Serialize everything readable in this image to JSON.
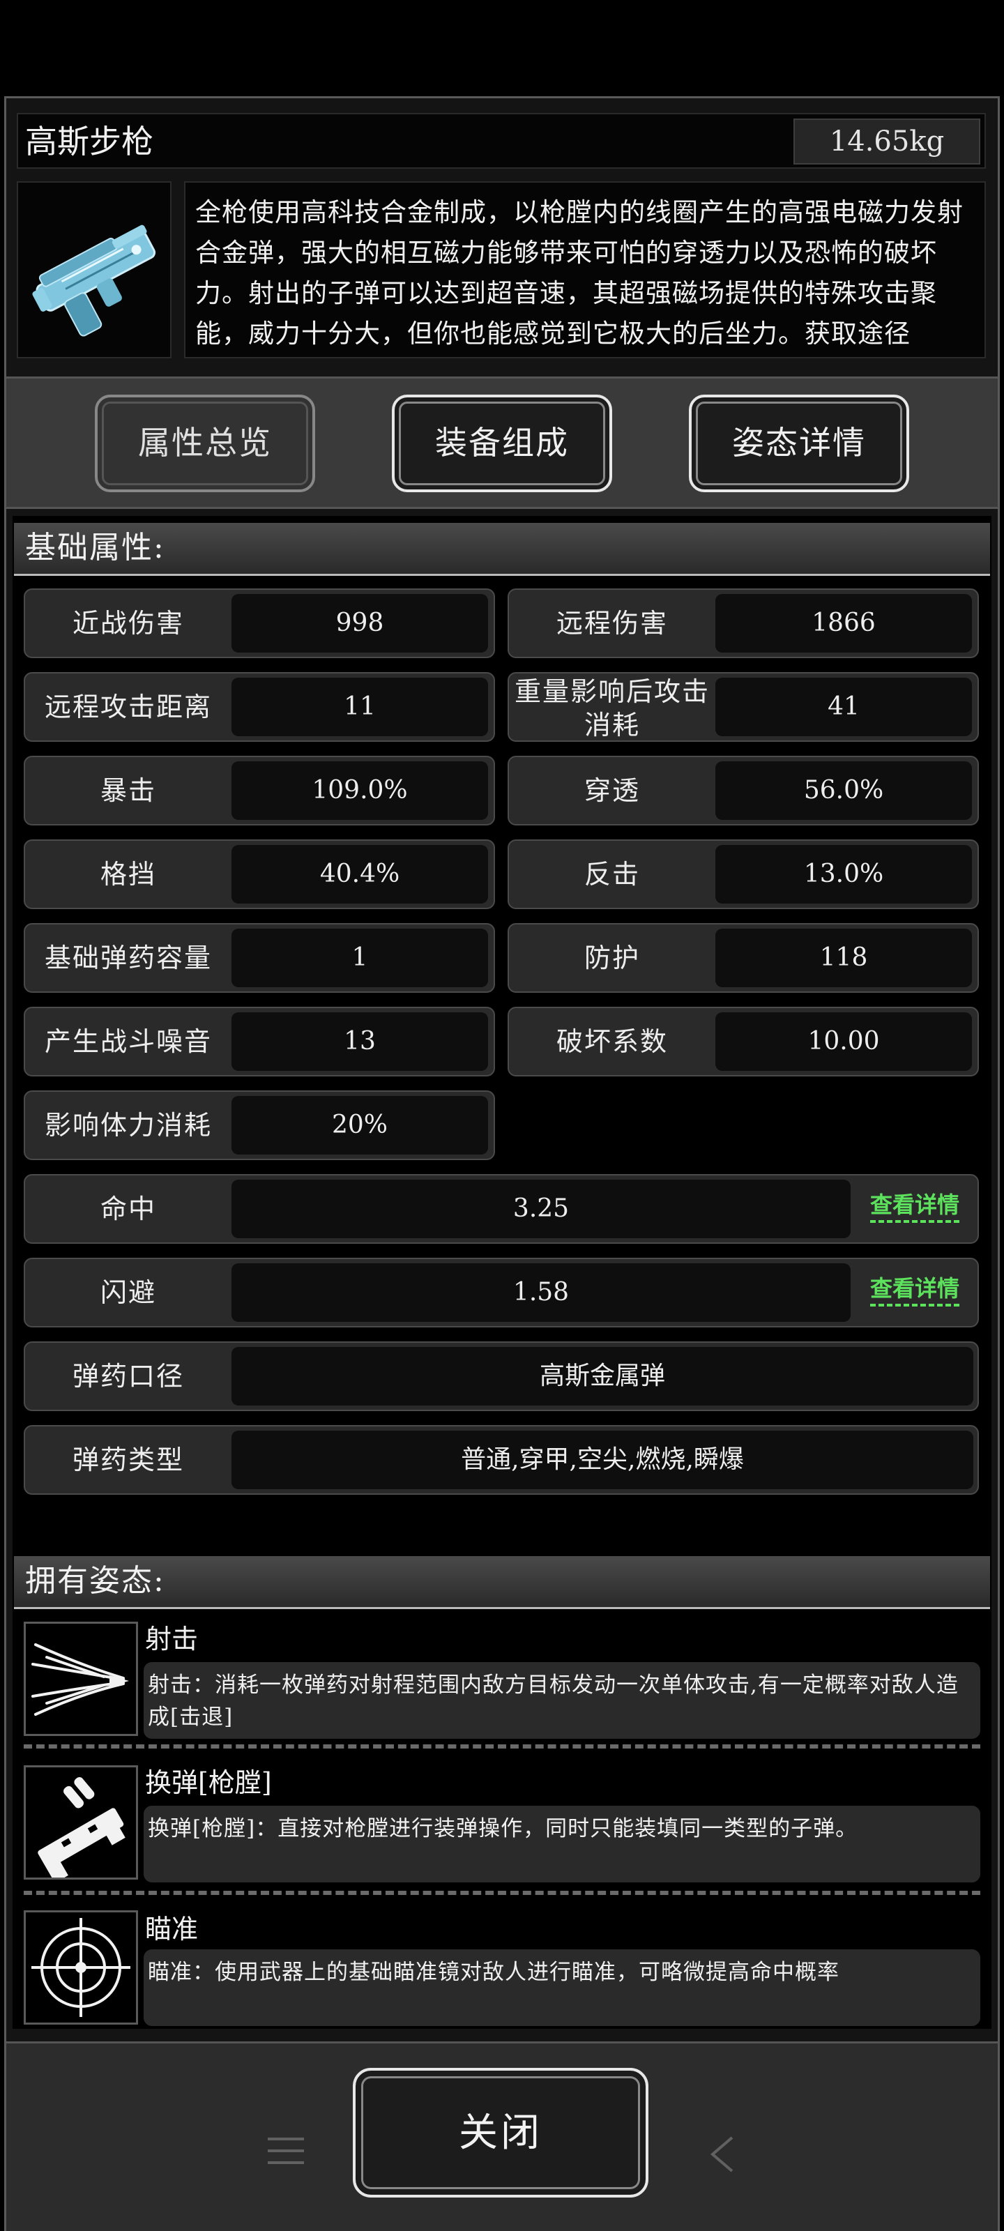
{
  "item": {
    "name": "高斯步枪",
    "weight": "14.65kg",
    "icon": "gauss-rifle-icon",
    "description": "全枪使用高科技合金制成，以枪膛内的线圈产生的高强电磁力发射合金弹，强大的相互磁力能够带来可怕的穿透力以及恐怖的破坏力。射出的子弹可以达到超音速，其超强磁场提供的特殊攻击聚能，威力十分大，但你也能感觉到它极大的后坐力。获取途径"
  },
  "tabs": [
    {
      "label": "属性总览",
      "active": true
    },
    {
      "label": "装备组成",
      "active": false
    },
    {
      "label": "姿态详情",
      "active": false
    }
  ],
  "basic": {
    "title": "基础属性:",
    "grid": [
      {
        "label": "近战伤害",
        "value": "998"
      },
      {
        "label": "远程伤害",
        "value": "1866"
      },
      {
        "label": "远程攻击距离",
        "value": "11"
      },
      {
        "label": "重量影响后攻击消耗",
        "value": "41"
      },
      {
        "label": "暴击",
        "value": "109.0%"
      },
      {
        "label": "穿透",
        "value": "56.0%"
      },
      {
        "label": "格挡",
        "value": "40.4%"
      },
      {
        "label": "反击",
        "value": "13.0%"
      },
      {
        "label": "基础弹药容量",
        "value": "1"
      },
      {
        "label": "防护",
        "value": "118"
      },
      {
        "label": "产生战斗噪音",
        "value": "13"
      },
      {
        "label": "破坏系数",
        "value": "10.00"
      },
      {
        "label": "影响体力消耗",
        "value": "20%"
      }
    ],
    "hit": {
      "label": "命中",
      "value": "3.25",
      "link": "查看详情"
    },
    "dodge": {
      "label": "闪避",
      "value": "1.58",
      "link": "查看详情"
    },
    "caliber": {
      "label": "弹药口径",
      "value": "高斯金属弹"
    },
    "ammo_type": {
      "label": "弹药类型",
      "value": "普通,穿甲,空尖,燃烧,瞬爆"
    }
  },
  "stances": {
    "title": "拥有姿态:",
    "items": [
      {
        "name": "射击",
        "icon": "shoot-icon",
        "desc": "射击：消耗一枚弹药对射程范围内敌方目标发动一次单体攻击,有一定概率对敌人造成[击退]"
      },
      {
        "name": "换弹[枪膛]",
        "icon": "reload-icon",
        "desc": "换弹[枪膛]：直接对枪膛进行装弹操作，同时只能装填同一类型的子弹。"
      },
      {
        "name": "瞄准",
        "icon": "crosshair-icon",
        "desc": "瞄准：使用武器上的基础瞄准镜对敌人进行瞄准，可略微提高命中概率"
      }
    ]
  },
  "footer": {
    "close_label": "关闭"
  }
}
